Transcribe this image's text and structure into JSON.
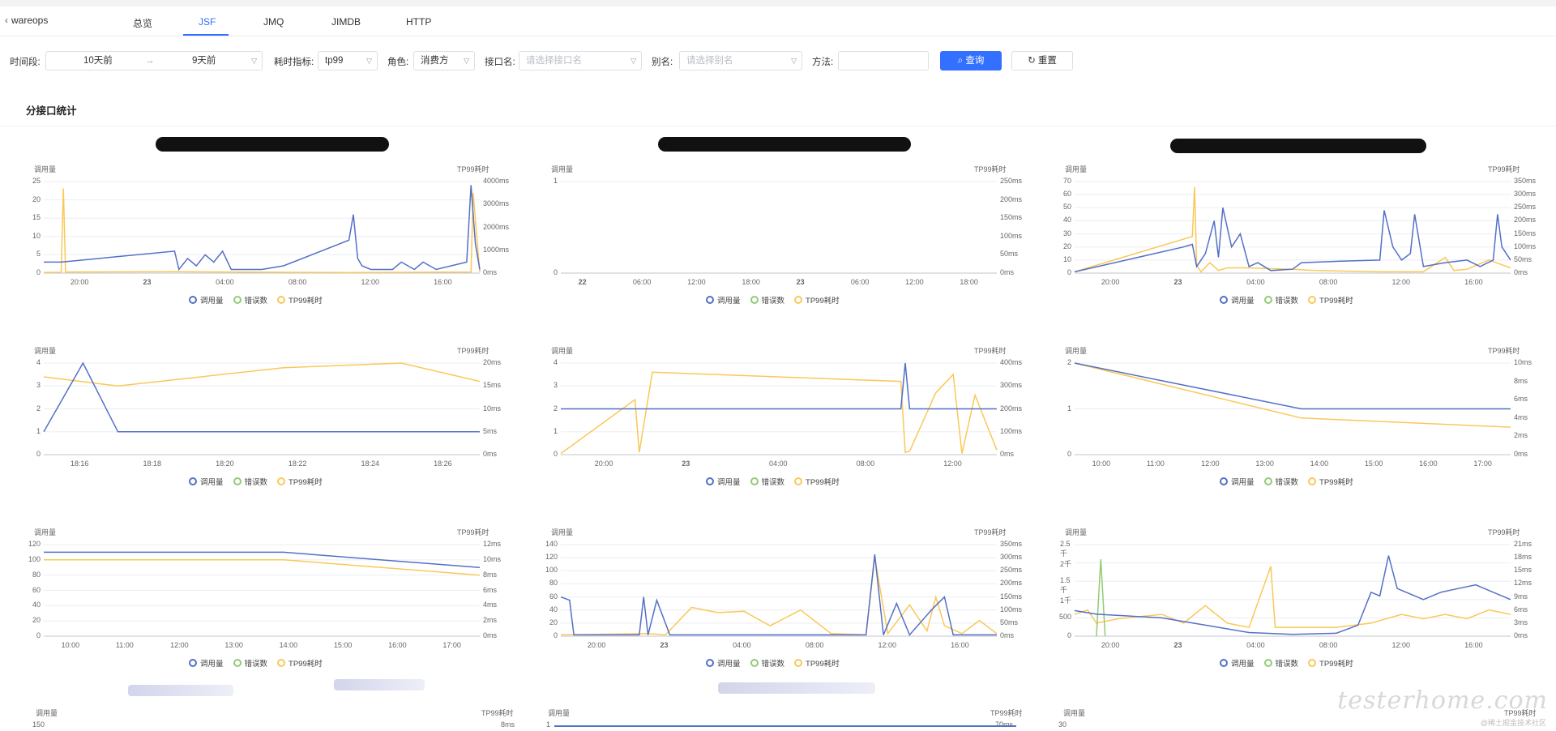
{
  "nav": {
    "back_label": "wareops",
    "tabs": [
      "总览",
      "JSF",
      "JMQ",
      "JIMDB",
      "HTTP"
    ],
    "active_tab": "JSF"
  },
  "filters": {
    "time_label": "时间段:",
    "time_start": "10天前",
    "time_arrow": "→",
    "time_end": "9天前",
    "metric_label": "耗时指标:",
    "metric_value": "tp99",
    "role_label": "角色:",
    "role_value": "消费方",
    "iface_label": "接口名:",
    "iface_placeholder": "请选择接口名",
    "alias_label": "别名:",
    "alias_placeholder": "请选择别名",
    "method_label": "方法:",
    "method_value": "",
    "query_button": "查询",
    "reset_button": "重置"
  },
  "section_title": "分接口统计",
  "legend": [
    "调用量",
    "错误数",
    "TP99耗时"
  ],
  "colors": {
    "calls": "#5470c6",
    "errors": "#91cc75",
    "tp99": "#fac858",
    "accent": "#3370ff"
  },
  "watermark": {
    "logo": "testerhome.com",
    "sub": "@稀土掘金技术社区"
  },
  "charts": [
    {
      "left_title": "调用量",
      "right_title": "TP99耗时",
      "y_left": [
        "0",
        "5",
        "10",
        "15",
        "20",
        "25"
      ],
      "y_right": [
        "0ms",
        "1000ms",
        "2000ms",
        "3000ms",
        "4000ms"
      ],
      "x_ticks": [
        "20:00",
        "23",
        "04:00",
        "08:00",
        "12:00",
        "16:00"
      ],
      "chart_data": {
        "type": "line",
        "left_max": 25,
        "right_max": 4000,
        "calls": [
          [
            0,
            3
          ],
          [
            0.04,
            3
          ],
          [
            0.3,
            6
          ],
          [
            0.31,
            1
          ],
          [
            0.33,
            4
          ],
          [
            0.35,
            2
          ],
          [
            0.37,
            5
          ],
          [
            0.39,
            3
          ],
          [
            0.41,
            6
          ],
          [
            0.43,
            1
          ],
          [
            0.5,
            1
          ],
          [
            0.55,
            2
          ],
          [
            0.7,
            9
          ],
          [
            0.71,
            16
          ],
          [
            0.72,
            4
          ],
          [
            0.73,
            2
          ],
          [
            0.75,
            1
          ],
          [
            0.8,
            1
          ],
          [
            0.82,
            3
          ],
          [
            0.85,
            1
          ],
          [
            0.87,
            3
          ],
          [
            0.9,
            1
          ],
          [
            0.97,
            3
          ],
          [
            0.98,
            24
          ],
          [
            0.99,
            8
          ],
          [
            1,
            1
          ]
        ],
        "tp99": [
          [
            0,
            30
          ],
          [
            0.04,
            40
          ],
          [
            0.045,
            3700
          ],
          [
            0.05,
            50
          ],
          [
            0.3,
            60
          ],
          [
            0.7,
            20
          ],
          [
            0.98,
            50
          ],
          [
            0.985,
            3500
          ],
          [
            1,
            40
          ]
        ]
      }
    },
    {
      "left_title": "调用量",
      "right_title": "TP99耗时",
      "y_left": [
        "0",
        "1"
      ],
      "y_right": [
        "0ms",
        "50ms",
        "100ms",
        "150ms",
        "200ms",
        "250ms"
      ],
      "x_ticks": [
        "22",
        "06:00",
        "12:00",
        "18:00",
        "23",
        "06:00",
        "12:00",
        "18:00"
      ],
      "chart_data": {
        "type": "line",
        "left_max": 1,
        "right_max": 250,
        "calls": [],
        "tp99": []
      }
    },
    {
      "left_title": "调用量",
      "right_title": "TP99耗时",
      "y_left": [
        "0",
        "10",
        "20",
        "30",
        "40",
        "50",
        "60",
        "70"
      ],
      "y_right": [
        "0ms",
        "50ms",
        "100ms",
        "150ms",
        "200ms",
        "250ms",
        "300ms",
        "350ms"
      ],
      "x_ticks": [
        "20:00",
        "23",
        "04:00",
        "08:00",
        "12:00",
        "16:00"
      ],
      "chart_data": {
        "type": "line",
        "left_max": 70,
        "right_max": 350,
        "calls": [
          [
            0,
            1
          ],
          [
            0.25,
            20
          ],
          [
            0.27,
            22
          ],
          [
            0.28,
            5
          ],
          [
            0.3,
            15
          ],
          [
            0.32,
            40
          ],
          [
            0.33,
            12
          ],
          [
            0.34,
            50
          ],
          [
            0.36,
            20
          ],
          [
            0.38,
            30
          ],
          [
            0.4,
            5
          ],
          [
            0.42,
            8
          ],
          [
            0.45,
            2
          ],
          [
            0.5,
            3
          ],
          [
            0.52,
            8
          ],
          [
            0.6,
            9
          ],
          [
            0.7,
            10
          ],
          [
            0.71,
            48
          ],
          [
            0.73,
            20
          ],
          [
            0.75,
            10
          ],
          [
            0.77,
            15
          ],
          [
            0.78,
            45
          ],
          [
            0.8,
            5
          ],
          [
            0.85,
            8
          ],
          [
            0.9,
            10
          ],
          [
            0.93,
            5
          ],
          [
            0.96,
            10
          ],
          [
            0.97,
            45
          ],
          [
            0.98,
            20
          ],
          [
            1,
            10
          ]
        ],
        "tp99": [
          [
            0,
            5
          ],
          [
            0.27,
            140
          ],
          [
            0.275,
            330
          ],
          [
            0.28,
            30
          ],
          [
            0.29,
            5
          ],
          [
            0.31,
            40
          ],
          [
            0.33,
            10
          ],
          [
            0.35,
            20
          ],
          [
            0.4,
            20
          ],
          [
            0.5,
            15
          ],
          [
            0.55,
            10
          ],
          [
            0.7,
            5
          ],
          [
            0.8,
            5
          ],
          [
            0.85,
            60
          ],
          [
            0.87,
            10
          ],
          [
            0.9,
            15
          ],
          [
            0.95,
            50
          ],
          [
            1,
            20
          ]
        ]
      }
    },
    {
      "left_title": "调用量",
      "right_title": "TP99耗时",
      "y_left": [
        "0",
        "1",
        "2",
        "3",
        "4"
      ],
      "y_right": [
        "0ms",
        "5ms",
        "10ms",
        "15ms",
        "20ms"
      ],
      "x_ticks": [
        "18:16",
        "18:18",
        "18:20",
        "18:22",
        "18:24",
        "18:26"
      ],
      "chart_data": {
        "type": "line",
        "left_max": 4,
        "right_max": 20,
        "calls": [
          [
            0,
            1
          ],
          [
            0.09,
            4
          ],
          [
            0.17,
            1
          ],
          [
            1,
            1
          ]
        ],
        "tp99": [
          [
            0,
            17
          ],
          [
            0.17,
            15
          ],
          [
            0.55,
            19
          ],
          [
            0.82,
            20
          ],
          [
            1,
            16
          ]
        ]
      }
    },
    {
      "left_title": "调用量",
      "right_title": "TP99耗时",
      "y_left": [
        "0",
        "1",
        "2",
        "3",
        "4"
      ],
      "y_right": [
        "0ms",
        "100ms",
        "200ms",
        "300ms",
        "400ms"
      ],
      "x_ticks": [
        "20:00",
        "23",
        "04:00",
        "08:00",
        "12:00"
      ],
      "chart_data": {
        "type": "line",
        "left_max": 4,
        "right_max": 400,
        "calls": [
          [
            0,
            2
          ],
          [
            0.78,
            2
          ],
          [
            0.79,
            4
          ],
          [
            0.8,
            2
          ],
          [
            1,
            2
          ]
        ],
        "tp99": [
          [
            0,
            5
          ],
          [
            0.17,
            240
          ],
          [
            0.18,
            10
          ],
          [
            0.21,
            360
          ],
          [
            0.78,
            320
          ],
          [
            0.79,
            10
          ],
          [
            0.8,
            15
          ],
          [
            0.86,
            270
          ],
          [
            0.9,
            350
          ],
          [
            0.92,
            5
          ],
          [
            0.95,
            260
          ],
          [
            1,
            20
          ]
        ]
      }
    },
    {
      "left_title": "调用量",
      "right_title": "TP99耗时",
      "y_left": [
        "0",
        "1",
        "2"
      ],
      "y_right": [
        "0ms",
        "2ms",
        "4ms",
        "6ms",
        "8ms",
        "10ms"
      ],
      "x_ticks": [
        "10:00",
        "11:00",
        "12:00",
        "13:00",
        "14:00",
        "15:00",
        "16:00",
        "17:00"
      ],
      "chart_data": {
        "type": "line",
        "left_max": 2,
        "right_max": 10,
        "calls": [
          [
            0,
            2
          ],
          [
            0.52,
            1
          ],
          [
            1,
            1
          ]
        ],
        "tp99": [
          [
            0,
            10
          ],
          [
            0.52,
            4
          ],
          [
            1,
            3
          ]
        ]
      }
    },
    {
      "left_title": "调用量",
      "right_title": "TP99耗时",
      "y_left": [
        "0",
        "20",
        "40",
        "60",
        "80",
        "100",
        "120"
      ],
      "y_right": [
        "0ms",
        "2ms",
        "4ms",
        "6ms",
        "8ms",
        "10ms",
        "12ms"
      ],
      "x_ticks": [
        "10:00",
        "11:00",
        "12:00",
        "13:00",
        "14:00",
        "15:00",
        "16:00",
        "17:00"
      ],
      "chart_data": {
        "type": "line",
        "left_max": 120,
        "right_max": 12,
        "calls": [
          [
            0,
            110
          ],
          [
            0.55,
            110
          ],
          [
            1,
            90
          ]
        ],
        "tp99": [
          [
            0,
            10
          ],
          [
            0.55,
            10
          ],
          [
            1,
            8
          ]
        ]
      }
    },
    {
      "left_title": "调用量",
      "right_title": "TP99耗时",
      "y_left": [
        "0",
        "20",
        "40",
        "60",
        "80",
        "100",
        "120",
        "140"
      ],
      "y_right": [
        "0ms",
        "50ms",
        "100ms",
        "150ms",
        "200ms",
        "250ms",
        "300ms",
        "350ms"
      ],
      "x_ticks": [
        "20:00",
        "23",
        "04:00",
        "08:00",
        "12:00",
        "16:00"
      ],
      "chart_data": {
        "type": "line",
        "left_max": 140,
        "right_max": 350,
        "calls": [
          [
            0,
            60
          ],
          [
            0.02,
            55
          ],
          [
            0.03,
            2
          ],
          [
            0.18,
            2
          ],
          [
            0.19,
            60
          ],
          [
            0.2,
            2
          ],
          [
            0.22,
            55
          ],
          [
            0.25,
            2
          ],
          [
            0.7,
            2
          ],
          [
            0.72,
            125
          ],
          [
            0.74,
            2
          ],
          [
            0.77,
            50
          ],
          [
            0.8,
            2
          ],
          [
            0.85,
            40
          ],
          [
            0.88,
            60
          ],
          [
            0.9,
            2
          ],
          [
            1,
            2
          ]
        ],
        "tp99": [
          [
            0,
            5
          ],
          [
            0.2,
            10
          ],
          [
            0.24,
            5
          ],
          [
            0.3,
            110
          ],
          [
            0.36,
            90
          ],
          [
            0.42,
            95
          ],
          [
            0.48,
            40
          ],
          [
            0.55,
            100
          ],
          [
            0.62,
            10
          ],
          [
            0.7,
            5
          ],
          [
            0.72,
            300
          ],
          [
            0.75,
            10
          ],
          [
            0.8,
            120
          ],
          [
            0.84,
            20
          ],
          [
            0.86,
            150
          ],
          [
            0.88,
            40
          ],
          [
            0.92,
            10
          ],
          [
            0.96,
            60
          ],
          [
            1,
            10
          ]
        ]
      }
    },
    {
      "left_title": "调用量",
      "right_title": "TP99耗时",
      "y_left": [
        "0",
        "500",
        "1千",
        "1.5千",
        "2千",
        "2.5千"
      ],
      "y_right": [
        "0ms",
        "3ms",
        "6ms",
        "9ms",
        "12ms",
        "15ms",
        "18ms",
        "21ms"
      ],
      "x_ticks": [
        "20:00",
        "23",
        "04:00",
        "08:00",
        "12:00",
        "16:00"
      ],
      "chart_data": {
        "type": "line",
        "left_max": 2500,
        "right_max": 21,
        "calls": [
          [
            0,
            700
          ],
          [
            0.05,
            600
          ],
          [
            0.2,
            500
          ],
          [
            0.3,
            300
          ],
          [
            0.4,
            100
          ],
          [
            0.5,
            50
          ],
          [
            0.6,
            80
          ],
          [
            0.65,
            300
          ],
          [
            0.68,
            1200
          ],
          [
            0.7,
            1100
          ],
          [
            0.72,
            2200
          ],
          [
            0.74,
            1300
          ],
          [
            0.8,
            1000
          ],
          [
            0.84,
            1200
          ],
          [
            0.88,
            1300
          ],
          [
            0.92,
            1400
          ],
          [
            0.96,
            1200
          ],
          [
            1,
            1000
          ]
        ],
        "tp99": [
          [
            0,
            5
          ],
          [
            0.03,
            6
          ],
          [
            0.05,
            3
          ],
          [
            0.1,
            4
          ],
          [
            0.2,
            5
          ],
          [
            0.25,
            3
          ],
          [
            0.3,
            7
          ],
          [
            0.35,
            3
          ],
          [
            0.4,
            2
          ],
          [
            0.45,
            16
          ],
          [
            0.46,
            2
          ],
          [
            0.6,
            2
          ],
          [
            0.68,
            3
          ],
          [
            0.75,
            5
          ],
          [
            0.8,
            4
          ],
          [
            0.85,
            5
          ],
          [
            0.9,
            4
          ],
          [
            0.95,
            6
          ],
          [
            1,
            5
          ]
        ],
        "errors": [
          [
            0.05,
            0
          ],
          [
            0.06,
            2100
          ],
          [
            0.07,
            0
          ]
        ]
      }
    }
  ],
  "bottom_row": {
    "left_title": "调用量",
    "right_title": "TP99耗时",
    "y_top": [
      "150",
      "1",
      "30"
    ],
    "y_right_top": [
      "8ms",
      "70ms"
    ]
  }
}
